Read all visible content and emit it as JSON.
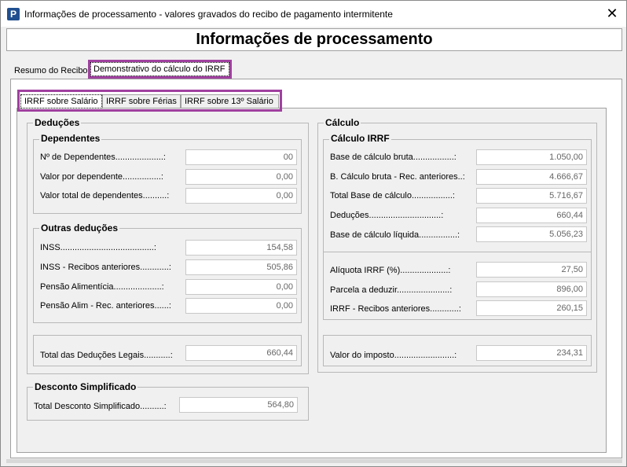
{
  "window": {
    "title": "Informações de processamento - valores gravados do recibo de pagamento intermitente",
    "app_icon": "P",
    "close_glyph": "✕"
  },
  "header": {
    "title": "Informações de processamento"
  },
  "tabs": [
    {
      "label": "Resumo do Recibo"
    },
    {
      "label": "Demonstrativo do cálculo do IRRF"
    }
  ],
  "subtabs": [
    {
      "label": "IRRF sobre Salário"
    },
    {
      "label": "IRRF sobre Férias"
    },
    {
      "label": "IRRF sobre 13º Salário"
    }
  ],
  "deducoes": {
    "title": "Deduções",
    "dependentes": {
      "title": "Dependentes",
      "rows": [
        {
          "label": "Nº de Dependentes....................:",
          "value": "00"
        },
        {
          "label": "Valor por dependente................:",
          "value": "0,00"
        },
        {
          "label": "Valor total de dependentes..........:",
          "value": "0,00"
        }
      ]
    },
    "outras": {
      "title": "Outras deduções",
      "rows": [
        {
          "label": "INSS.......................................:",
          "value": "154,58"
        },
        {
          "label": "INSS - Recibos anteriores............:",
          "value": "505,86"
        },
        {
          "label": "Pensão Alimentícia....................:",
          "value": "0,00"
        },
        {
          "label": "Pensão Alim - Rec. anteriores......:",
          "value": "0,00"
        }
      ]
    },
    "total": {
      "label": "Total das Deduções Legais...........:",
      "value": "660,44"
    }
  },
  "desconto": {
    "title": "Desconto Simplificado",
    "label": "Total Desconto Simplificado..........:",
    "value": "564,80"
  },
  "calculo": {
    "title": "Cálculo",
    "irrf": {
      "title": "Cálculo IRRF",
      "rows": [
        {
          "label": "Base de cálculo bruta.................:",
          "value": "1.050,00"
        },
        {
          "label": "B. Cálculo bruta - Rec. anteriores..:",
          "value": "4.666,67"
        },
        {
          "label": "Total Base de cálculo.................:",
          "value": "5.716,67"
        },
        {
          "label": "Deduções..............................:",
          "value": "660,44"
        },
        {
          "label": "Base de cálculo líquida................:",
          "value": "5.056,23"
        }
      ],
      "rows2": [
        {
          "label": "Alíquota IRRF (%)....................:",
          "value": "27,50"
        },
        {
          "label": "Parcela a deduzir......................:",
          "value": "896,00"
        },
        {
          "label": "IRRF - Recibos anteriores............:",
          "value": "260,15"
        }
      ]
    },
    "imposto": {
      "label": "Valor do imposto.........................:",
      "value": "234,31"
    }
  }
}
